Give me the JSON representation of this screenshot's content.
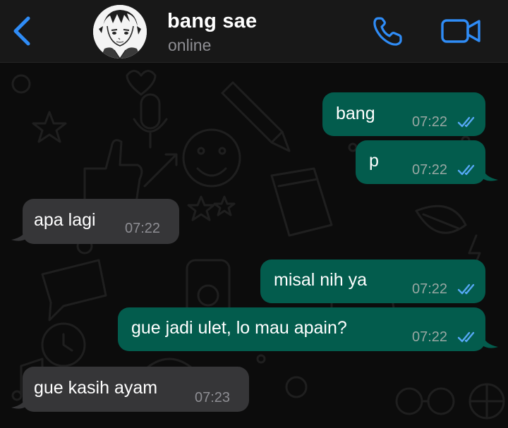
{
  "header": {
    "contact_name": "bang sae",
    "status": "online",
    "back_icon": "chevron-left-icon",
    "call_icon": "phone-icon",
    "video_icon": "video-camera-icon"
  },
  "colors": {
    "header_bg": "#181818",
    "accent_blue": "#2f8cf6",
    "outgoing_bubble": "#035c4d",
    "incoming_bubble": "#363638",
    "read_ticks": "#56a8f5"
  },
  "messages": [
    {
      "direction": "out",
      "text": "bang",
      "time": "07:22",
      "status": "read"
    },
    {
      "direction": "out",
      "text": "p",
      "time": "07:22",
      "status": "read"
    },
    {
      "direction": "in",
      "text": "apa lagi",
      "time": "07:22"
    },
    {
      "direction": "out",
      "text": "misal nih ya",
      "time": "07:22",
      "status": "read"
    },
    {
      "direction": "out",
      "text": "gue jadi ulet, lo mau apain?",
      "time": "07:22",
      "status": "read"
    },
    {
      "direction": "in",
      "text": "gue kasih ayam",
      "time": "07:23"
    }
  ]
}
